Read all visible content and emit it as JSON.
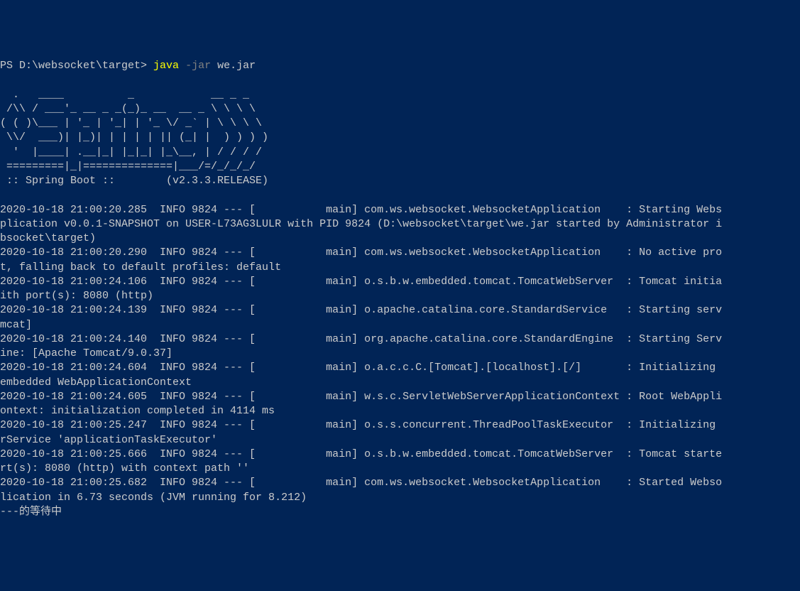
{
  "prompt": {
    "ps": "PS D:\\websocket\\target> ",
    "cmd": "java",
    "arg": " -jar",
    "file": " we.jar"
  },
  "ascii": {
    "l1": "",
    "l2": "  .   ____          _            __ _ _",
    "l3": " /\\\\ / ___'_ __ _ _(_)_ __  __ _ \\ \\ \\ \\",
    "l4": "( ( )\\___ | '_ | '_| | '_ \\/ _` | \\ \\ \\ \\",
    "l5": " \\\\/  ___)| |_)| | | | | || (_| |  ) ) ) )",
    "l6": "  '  |____| .__|_| |_|_| |_\\__, | / / / /",
    "l7": " =========|_|==============|___/=/_/_/_/",
    "l8": " :: Spring Boot ::        (v2.3.3.RELEASE)",
    "l9": ""
  },
  "logs": {
    "l1": "2020-10-18 21:00:20.285  INFO 9824 --- [           main] com.ws.websocket.WebsocketApplication    : Starting Webs",
    "l2": "plication v0.0.1-SNAPSHOT on USER-L73AG3LULR with PID 9824 (D:\\websocket\\target\\we.jar started by Administrator i",
    "l3": "bsocket\\target)",
    "l4": "2020-10-18 21:00:20.290  INFO 9824 --- [           main] com.ws.websocket.WebsocketApplication    : No active pro",
    "l5": "t, falling back to default profiles: default",
    "l6": "2020-10-18 21:00:24.106  INFO 9824 --- [           main] o.s.b.w.embedded.tomcat.TomcatWebServer  : Tomcat initia",
    "l7": "ith port(s): 8080 (http)",
    "l8": "2020-10-18 21:00:24.139  INFO 9824 --- [           main] o.apache.catalina.core.StandardService   : Starting serv",
    "l9": "mcat]",
    "l10": "2020-10-18 21:00:24.140  INFO 9824 --- [           main] org.apache.catalina.core.StandardEngine  : Starting Serv",
    "l11": "ine: [Apache Tomcat/9.0.37]",
    "l12": "2020-10-18 21:00:24.604  INFO 9824 --- [           main] o.a.c.c.C.[Tomcat].[localhost].[/]       : Initializing ",
    "l13": "embedded WebApplicationContext",
    "l14": "2020-10-18 21:00:24.605  INFO 9824 --- [           main] w.s.c.ServletWebServerApplicationContext : Root WebAppli",
    "l15": "ontext: initialization completed in 4114 ms",
    "l16": "2020-10-18 21:00:25.247  INFO 9824 --- [           main] o.s.s.concurrent.ThreadPoolTaskExecutor  : Initializing ",
    "l17": "rService 'applicationTaskExecutor'",
    "l18": "2020-10-18 21:00:25.666  INFO 9824 --- [           main] o.s.b.w.embedded.tomcat.TomcatWebServer  : Tomcat starte",
    "l19": "rt(s): 8080 (http) with context path ''",
    "l20": "2020-10-18 21:00:25.682  INFO 9824 --- [           main] com.ws.websocket.WebsocketApplication    : Started Webso",
    "l21": "lication in 6.73 seconds (JVM running for 8.212)",
    "l22": "---的等待中"
  }
}
